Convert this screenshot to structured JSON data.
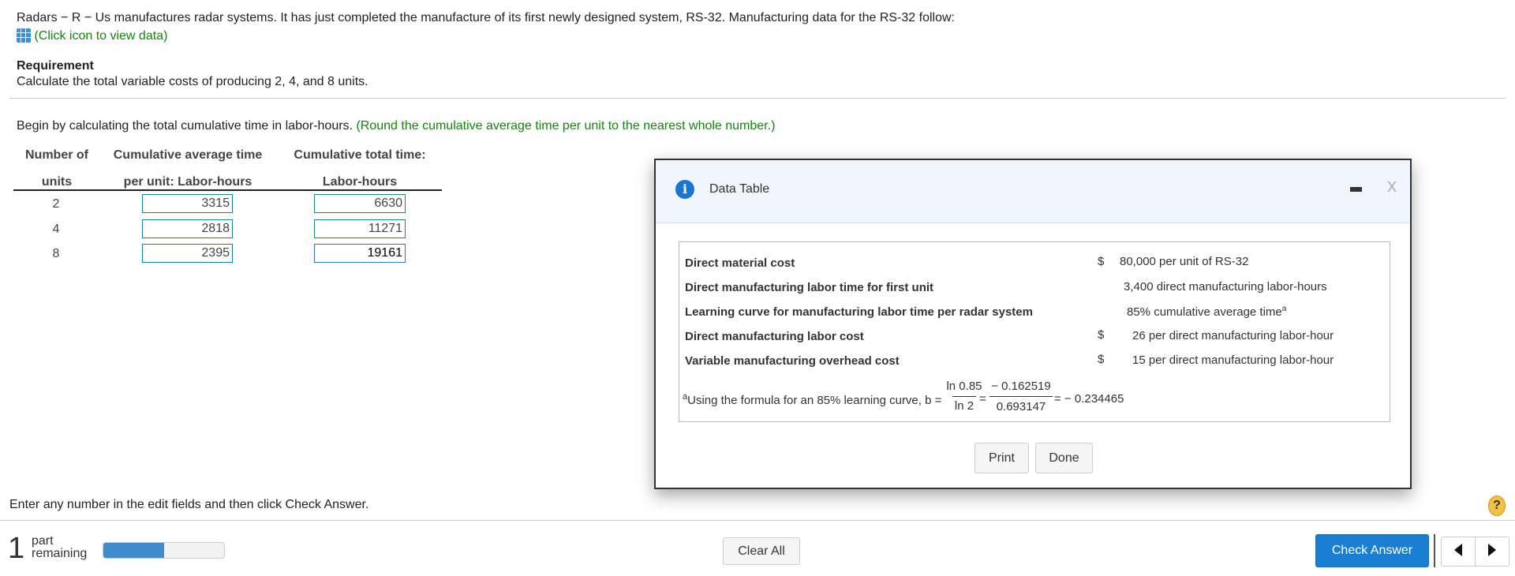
{
  "problem": {
    "intro": "Radars − R − Us manufactures radar systems. It has just completed the manufacture of its first newly designed system, RS-32. Manufacturing data for the RS-32 follow:",
    "data_link": "(Click icon to view data)",
    "requirement_title": "Requirement",
    "requirement_text": "Calculate the total variable costs of producing 2, 4, and 8 units.",
    "instruction": "Begin by calculating the total cumulative time in labor-hours.",
    "instruction_hint": "(Round the cumulative average time per unit to the nearest whole number.)"
  },
  "table": {
    "headers": [
      [
        "Number of",
        "units"
      ],
      [
        "Cumulative average time",
        "per unit: Labor-hours"
      ],
      [
        "Cumulative total time:",
        "Labor-hours"
      ]
    ],
    "rows": [
      {
        "units": "2",
        "avg": "3315",
        "total": "6630"
      },
      {
        "units": "4",
        "avg": "2818",
        "total": "11271"
      },
      {
        "units": "8",
        "avg": "2395",
        "total": "19161"
      }
    ]
  },
  "modal": {
    "title": "Data Table",
    "minimize": "▬",
    "close": "X",
    "rows": [
      {
        "label": "Direct material cost",
        "dollar": "$",
        "value": "80,000 per unit of RS-32"
      },
      {
        "label": "Direct manufacturing labor time for first unit",
        "dollar": "",
        "value": "3,400 direct manufacturing labor-hours"
      },
      {
        "label": "Learning curve for manufacturing labor time per radar system",
        "dollar": "",
        "value": "85% cumulative average time",
        "sup": "a"
      },
      {
        "label": "Direct manufacturing labor cost",
        "dollar": "$",
        "value": "26 per direct manufacturing labor-hour"
      },
      {
        "label": "Variable manufacturing overhead cost",
        "dollar": "$",
        "value": "15 per direct manufacturing labor-hour"
      }
    ],
    "footnote": {
      "sup": "a",
      "text": "Using the formula for an 85% learning curve, b =",
      "num1": "ln 0.85",
      "den1": "ln 2",
      "eq": "=",
      "num2": "− 0.162519",
      "den2": "0.693147",
      "result": "= − 0.234465"
    },
    "print": "Print",
    "done": "Done"
  },
  "footer": {
    "hint": "Enter any number in the edit fields and then click Check Answer.",
    "help": "?",
    "parts_count": "1",
    "parts_label1": "part",
    "parts_label2": "remaining",
    "progress": 0.5,
    "clear_all": "Clear All",
    "check_answer": "Check Answer"
  },
  "colors": {
    "accent": "#1a7fd0",
    "green": "#16830e",
    "progress": "#3f8ccc"
  }
}
